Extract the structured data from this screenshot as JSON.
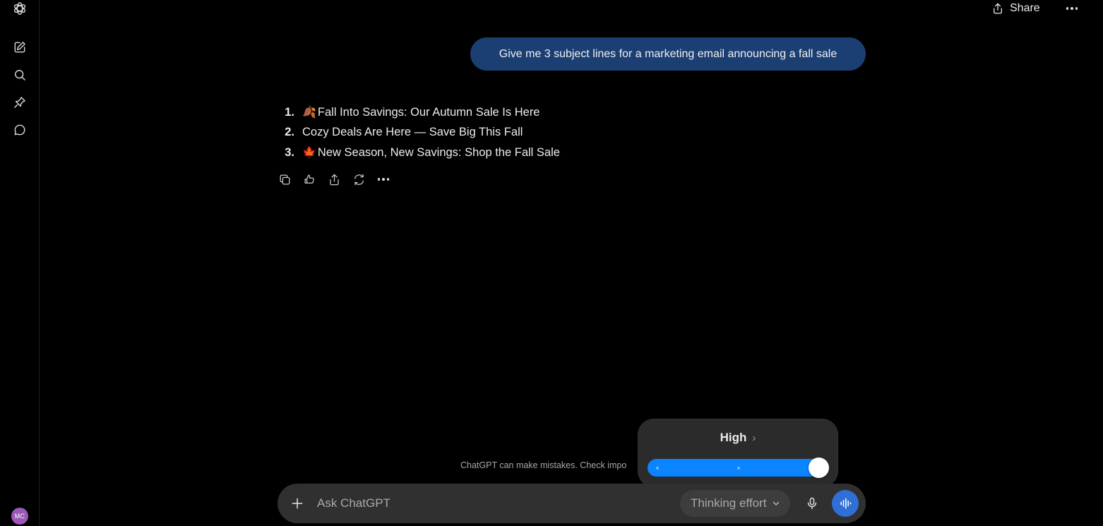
{
  "header": {
    "share_label": "Share"
  },
  "sidebar": {
    "items": [
      {
        "name": "new-chat",
        "icon": "edit-icon"
      },
      {
        "name": "search",
        "icon": "search-icon"
      },
      {
        "name": "pinned",
        "icon": "pin-icon"
      },
      {
        "name": "chats",
        "icon": "chat-bubble-icon"
      }
    ],
    "avatar_initials": "MC",
    "avatar_color": "#9b59b6"
  },
  "conversation": {
    "user_message": "Give me 3 subject lines for a marketing email announcing a fall sale",
    "assistant_items": [
      {
        "number": "1.",
        "emoji": "🍂",
        "text": "Fall Into Savings: Our Autumn Sale Is Here"
      },
      {
        "number": "2.",
        "emoji": "",
        "text": "Cozy Deals Are Here — Save Big This Fall"
      },
      {
        "number": "3.",
        "emoji": "🍁",
        "text": "New Season, New Savings: Shop the Fall Sale"
      }
    ],
    "actions": [
      "copy-icon",
      "feedback-icon",
      "share-icon",
      "regenerate-icon",
      "more-icon"
    ]
  },
  "effort_popup": {
    "level_label": "High",
    "chevron": "›",
    "slider": {
      "stops": 3,
      "selected_index": 2,
      "value_fraction": 1.0
    },
    "accent_color": "#0a84ff"
  },
  "disclaimer": "ChatGPT can make mistakes. Check impo",
  "composer": {
    "placeholder": "Ask ChatGPT",
    "effort_chip_label": "Thinking effort"
  },
  "colors": {
    "user_bubble": "#1c3f73",
    "voice_button": "#2f6fd6"
  }
}
